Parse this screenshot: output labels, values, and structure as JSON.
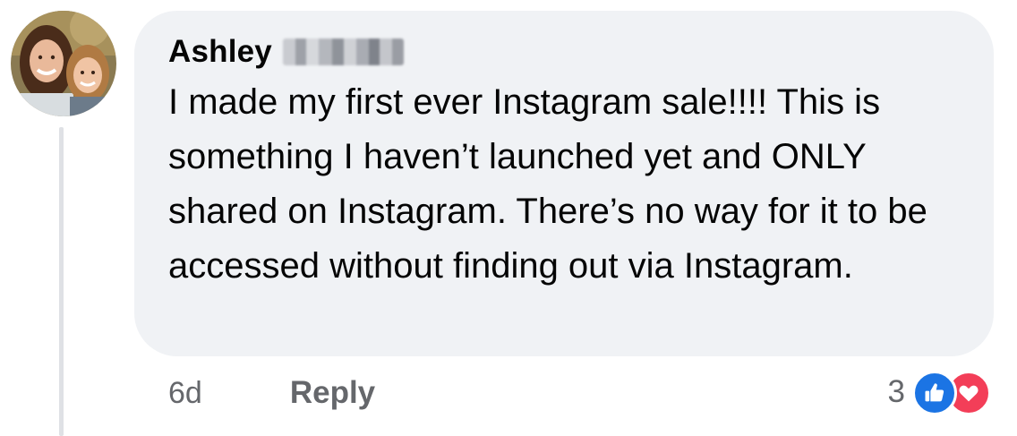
{
  "comment": {
    "author_first_name": "Ashley",
    "author_surname_blurred": true,
    "text_highlighted": "I made my first ever Instagram sale!!!!",
    "text_rest": " This is something I haven’t launched yet and ONLY shared on Instagram. There’s no way for it to be accessed without finding out via Instagram."
  },
  "footer": {
    "timestamp": "6d",
    "reply_label": "Reply",
    "reaction_count": "3",
    "reaction_icons": [
      "like-icon",
      "love-icon"
    ]
  },
  "colors": {
    "bubble_background": "#f0f2f5",
    "highlight": "#c9f25a",
    "meta_text": "#65676b",
    "like_blue": "#1b74e4",
    "love_red": "#f33e58"
  }
}
